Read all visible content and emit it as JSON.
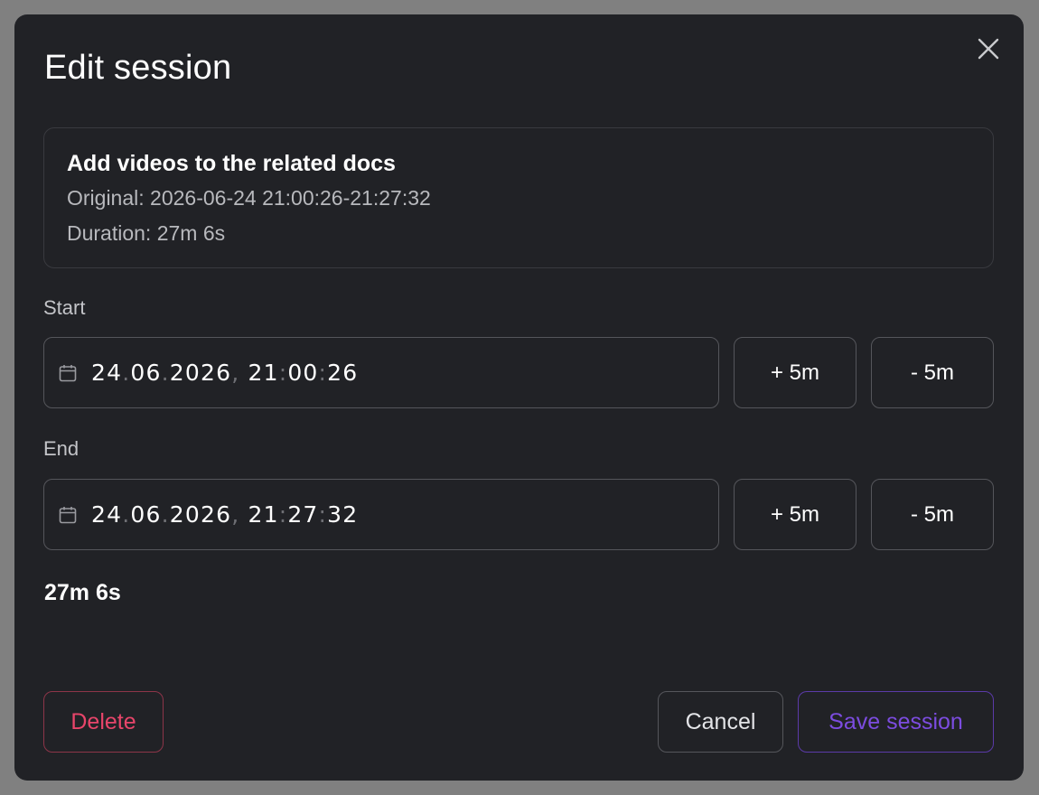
{
  "dialog": {
    "title": "Edit session",
    "close_label": "close"
  },
  "session": {
    "name": "Add videos to the related docs",
    "original": "Original: 2026-06-24 21:00:26-21:27:32",
    "duration_line": "Duration: 27m 6s"
  },
  "start": {
    "label": "Start",
    "day": "24",
    "month": "06",
    "year": "2026",
    "hour": "21",
    "minute": "00",
    "second": "26",
    "plus_label": "+ 5m",
    "minus_label": "- 5m"
  },
  "end": {
    "label": "End",
    "day": "24",
    "month": "06",
    "year": "2026",
    "hour": "21",
    "minute": "27",
    "second": "32",
    "plus_label": "+ 5m",
    "minus_label": "- 5m"
  },
  "computed_duration": "27m 6s",
  "actions": {
    "delete_label": "Delete",
    "cancel_label": "Cancel",
    "save_label": "Save session"
  },
  "colors": {
    "modal_bg": "#212226",
    "delete": "#e8456a",
    "save": "#7c4ce0"
  },
  "icons": {
    "close": "close-icon",
    "calendar": "calendar-icon"
  }
}
